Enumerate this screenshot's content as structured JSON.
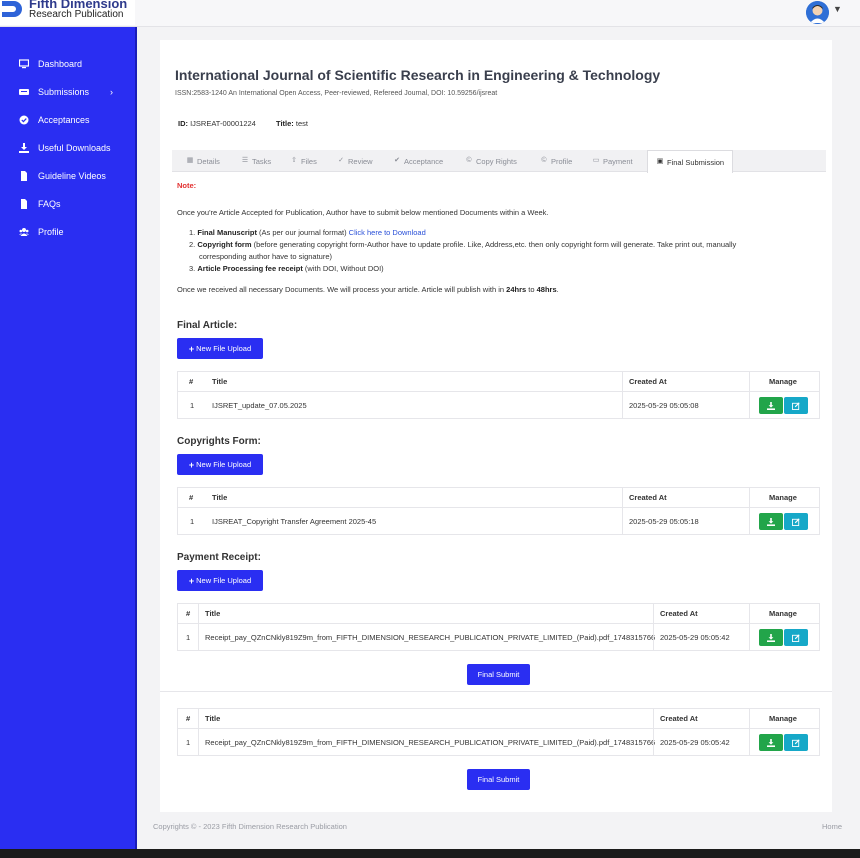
{
  "brand": {
    "line1": "Fifth Dimension",
    "line2": "Research Publication",
    "accent": "#2a2ef2"
  },
  "sidebar": {
    "items": [
      {
        "label": "Dashboard",
        "icon": "monitor-icon"
      },
      {
        "label": "Submissions",
        "icon": "list-icon",
        "caret": "›"
      },
      {
        "label": "Acceptances",
        "icon": "check-circle-icon"
      },
      {
        "label": "Useful Downloads",
        "icon": "download-icon"
      },
      {
        "label": "Guideline Videos",
        "icon": "file-icon"
      },
      {
        "label": "FAQs",
        "icon": "file-icon"
      },
      {
        "label": "Profile",
        "icon": "users-icon"
      }
    ]
  },
  "journal": {
    "title": "International Journal of Scientific Research in Engineering & Technology",
    "subtitle": "ISSN:2583-1240 An International Open Access, Peer-reviewed, Refereed Journal, DOI: 10.59256/ijsreat"
  },
  "article": {
    "id_label": "ID:",
    "id_value": "IJSREAT-00001224",
    "title_label": "Title:",
    "title_value": "test"
  },
  "tabs": [
    {
      "label": "Details",
      "icon": "grid-icon"
    },
    {
      "label": "Tasks",
      "icon": "list-icon"
    },
    {
      "label": "Files",
      "icon": "upload-icon"
    },
    {
      "label": "Review",
      "icon": "check-icon"
    },
    {
      "label": "Acceptance",
      "icon": "check-circle-icon"
    },
    {
      "label": "Copy Rights",
      "icon": "copyright-icon"
    },
    {
      "label": "Profile",
      "icon": "copyright-icon"
    },
    {
      "label": "Payment",
      "icon": "card-icon"
    },
    {
      "label": "Final Submission",
      "icon": "image-icon",
      "active": true
    }
  ],
  "note": {
    "label": "Note:",
    "intro": "Once you're Article Accepted for Publication, Author have to submit below mentioned Documents within a Week.",
    "item1_num": "1.",
    "item1_bold": "Final Manuscript",
    "item1_text": " (As per our journal format) ",
    "item1_link": "Click here to Download",
    "item2_num": "2.",
    "item2_bold": "Copyright form",
    "item2_text": " (before generating copyright form-Author have to update profile. Like, Address,etc. then only copyright form will generate. Take print out, manually",
    "item2_text2": "corresponding author have to signature)",
    "item3_num": "3.",
    "item3_bold": "Article Processing fee receipt",
    "item3_text": " (with DOI, Without DOI)",
    "outro_a": "Once we received all necessary Documents. We will process your article. Article will publish with in ",
    "outro_b": "24hrs",
    "outro_c": " to ",
    "outro_d": "48hrs",
    "outro_e": "."
  },
  "upload_label": "New File Upload",
  "table_headers": {
    "num": "#",
    "title": "Title",
    "created": "Created At",
    "manage": "Manage"
  },
  "sections": [
    {
      "title": "Final Article:",
      "rows": [
        {
          "num": "1",
          "title": "IJSRET_update_07.05.2025",
          "created": "2025-05-29 05:05:08"
        }
      ]
    },
    {
      "title": "Copyrights Form:",
      "rows": [
        {
          "num": "1",
          "title": "IJSREAT_Copyright Transfer Agreement 2025-45",
          "created": "2025-05-29 05:05:18"
        }
      ]
    },
    {
      "title": "Payment Receipt:",
      "rows": [
        {
          "num": "1",
          "title": "Receipt_pay_QZnCNkly819Z9m_from_FIFTH_DIMENSION_RESEARCH_PUBLICATION_PRIVATE_LIMITED_(Paid).pdf_1748315766",
          "created": "2025-05-29 05:05:42"
        }
      ]
    }
  ],
  "extra_table": {
    "rows": [
      {
        "num": "1",
        "title": "Receipt_pay_QZnCNkly819Z9m_from_FIFTH_DIMENSION_RESEARCH_PUBLICATION_PRIVATE_LIMITED_(Paid).pdf_1748315766",
        "created": "2025-05-29 05:05:42"
      }
    ]
  },
  "final_submit_label": "Final Submit",
  "footer": {
    "copyright": "Copyrights © - 2023 Fifth Dimension Research Publication",
    "home": "Home"
  }
}
